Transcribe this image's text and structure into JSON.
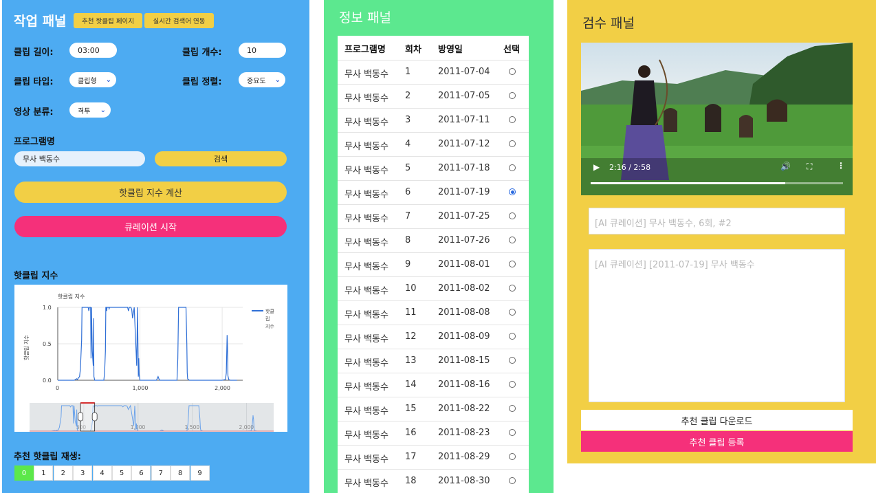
{
  "work": {
    "title": "작업 패널",
    "btn_hotclip_page": "추천 핫클립 페이지",
    "btn_realtime": "실시간 검색어 연동",
    "clip_length_label": "클립 길이:",
    "clip_length_value": "03:00",
    "clip_count_label": "클립 개수:",
    "clip_count_value": "10",
    "clip_type_label": "클립 타입:",
    "clip_type_value": "클립형",
    "clip_sort_label": "클립 정렬:",
    "clip_sort_value": "중요도",
    "video_class_label": "영상 분류:",
    "video_class_value": "격투",
    "program_label": "프로그램명",
    "program_value": "무사 백동수",
    "search_btn": "검색",
    "calc_btn": "핫클립 지수 계산",
    "curate_btn": "큐레이션 시작",
    "chart_section_label": "핫클립 지수",
    "play_label": "추천 핫클립 재생:",
    "clip_numbers": [
      "0",
      "1",
      "2",
      "3",
      "4",
      "5",
      "6",
      "7",
      "8",
      "9"
    ],
    "accent_blue": "#4dabf2",
    "accent_yellow": "#f2cf45",
    "accent_pink": "#f5307a"
  },
  "chart_data": {
    "type": "line",
    "title": "핫클립 지수",
    "ylabel": "핫클립 지수",
    "xlabel": "",
    "xlim": [
      0,
      2250
    ],
    "ylim": [
      0,
      1.0
    ],
    "x_ticks": [
      "0",
      "1,000",
      "2,000"
    ],
    "y_ticks": [
      "0.0",
      "0.5",
      "1.0"
    ],
    "legend": "핫클립 지수",
    "legend_lines": [
      "핫클",
      "립",
      "지수"
    ],
    "legend_position": "top-right",
    "grid": true,
    "series": [
      {
        "name": "핫클립 지수",
        "x": [
          0,
          200,
          230,
          240,
          250,
          265,
          275,
          290,
          295,
          370,
          378,
          385,
          400,
          405,
          410,
          420,
          432,
          435,
          438,
          440,
          450,
          560,
          570,
          580,
          585,
          590,
          595,
          600,
          610,
          620,
          625,
          630,
          640,
          650,
          850,
          860,
          870,
          880,
          890,
          900,
          910,
          930,
          960,
          970,
          980,
          985,
          990,
          1000,
          1200,
          1220,
          1230,
          1240,
          1450,
          1460,
          1470,
          1480,
          1500,
          1560,
          1570,
          1575,
          1580,
          1600,
          1700,
          1900,
          2000,
          2040,
          2050,
          2060,
          2065,
          2070,
          2080,
          2100,
          2180
        ],
        "y": [
          0,
          0,
          0.02,
          0.01,
          0.03,
          0.05,
          0.15,
          0.55,
          1.0,
          1.0,
          0.95,
          1.0,
          1.0,
          0.3,
          1.0,
          0.4,
          0.2,
          0.85,
          0.3,
          0.05,
          0,
          0,
          0.1,
          0.4,
          1.0,
          1.0,
          0.95,
          1.0,
          1.0,
          1.0,
          0.98,
          1.0,
          1.0,
          1.0,
          1.0,
          0.95,
          1.0,
          1.0,
          1.0,
          0.97,
          0.85,
          1.0,
          0.2,
          1.0,
          0.05,
          0.3,
          0.08,
          0,
          0,
          0.05,
          0.02,
          0,
          0,
          0.3,
          1.0,
          1.0,
          1.0,
          1.0,
          0.5,
          0.1,
          0.02,
          0,
          0,
          0,
          0,
          0.01,
          0.1,
          0.62,
          0.45,
          0.06,
          0.01,
          0,
          0
        ]
      }
    ],
    "navigator_ticks": [
      "500",
      "1,000",
      "1,500",
      "2,000"
    ],
    "navigator_selection": [
      470,
      600
    ]
  },
  "info": {
    "title": "정보 패널",
    "headers": {
      "program": "프로그램명",
      "episode": "회차",
      "airdate": "방영일",
      "select": "선택"
    },
    "rows": [
      {
        "program": "무사 백동수",
        "episode": "1",
        "airdate": "2011-07-04",
        "selected": false
      },
      {
        "program": "무사 백동수",
        "episode": "2",
        "airdate": "2011-07-05",
        "selected": false
      },
      {
        "program": "무사 백동수",
        "episode": "3",
        "airdate": "2011-07-11",
        "selected": false
      },
      {
        "program": "무사 백동수",
        "episode": "4",
        "airdate": "2011-07-12",
        "selected": false
      },
      {
        "program": "무사 백동수",
        "episode": "5",
        "airdate": "2011-07-18",
        "selected": false
      },
      {
        "program": "무사 백동수",
        "episode": "6",
        "airdate": "2011-07-19",
        "selected": true
      },
      {
        "program": "무사 백동수",
        "episode": "7",
        "airdate": "2011-07-25",
        "selected": false
      },
      {
        "program": "무사 백동수",
        "episode": "8",
        "airdate": "2011-07-26",
        "selected": false
      },
      {
        "program": "무사 백동수",
        "episode": "9",
        "airdate": "2011-08-01",
        "selected": false
      },
      {
        "program": "무사 백동수",
        "episode": "10",
        "airdate": "2011-08-02",
        "selected": false
      },
      {
        "program": "무사 백동수",
        "episode": "11",
        "airdate": "2011-08-08",
        "selected": false
      },
      {
        "program": "무사 백동수",
        "episode": "12",
        "airdate": "2011-08-09",
        "selected": false
      },
      {
        "program": "무사 백동수",
        "episode": "13",
        "airdate": "2011-08-15",
        "selected": false
      },
      {
        "program": "무사 백동수",
        "episode": "14",
        "airdate": "2011-08-16",
        "selected": false
      },
      {
        "program": "무사 백동수",
        "episode": "15",
        "airdate": "2011-08-22",
        "selected": false
      },
      {
        "program": "무사 백동수",
        "episode": "16",
        "airdate": "2011-08-23",
        "selected": false
      },
      {
        "program": "무사 백동수",
        "episode": "17",
        "airdate": "2011-08-29",
        "selected": false
      },
      {
        "program": "무사 백동수",
        "episode": "18",
        "airdate": "2011-08-30",
        "selected": false
      }
    ]
  },
  "review": {
    "title": "검수 패널",
    "video_time": "2:16 / 2:58",
    "video_progress": 0.77,
    "title_field_placeholder": "[AI 큐레이션] 무사 백동수, 6회, #2",
    "desc_field_placeholder": "[AI 큐레이션] [2011-07-19] 무사 백동수",
    "download_btn": "추천 클립 다운로드",
    "register_btn": "추천 클립 등록"
  }
}
